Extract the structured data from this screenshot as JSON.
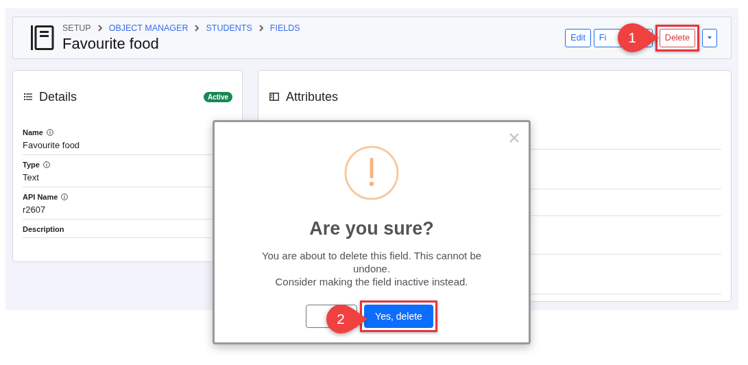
{
  "header": {
    "breadcrumb": [
      {
        "label": "SETUP",
        "link": false
      },
      {
        "label": "OBJECT MANAGER",
        "link": true
      },
      {
        "label": "STUDENTS",
        "link": true
      },
      {
        "label": "FIELDS",
        "link": true
      }
    ],
    "title": "Favourite food",
    "buttons": [
      {
        "label": "Edit",
        "kind": "outline",
        "highlighted": false
      },
      {
        "label": "Fi",
        "kind": "outline",
        "highlighted": false
      },
      {
        "label": "Delete",
        "kind": "danger",
        "highlighted": true
      },
      {
        "kind": "dropdown",
        "highlighted": false
      }
    ]
  },
  "details": {
    "title": "Details",
    "status": "Active",
    "fields": [
      {
        "label": "Name",
        "info": true,
        "value": "Favourite food"
      },
      {
        "label": "Type",
        "info": true,
        "value": "Text"
      },
      {
        "label": "API Name",
        "info": true,
        "value": "r2607"
      },
      {
        "label": "Description",
        "info": false
      }
    ]
  },
  "attributes": {
    "title": "Attributes"
  },
  "dialog": {
    "title": "Are you sure?",
    "message_lines": [
      "You are about to delete this field. This cannot be undone.",
      "Consider making the field inactive instead."
    ],
    "buttons": [
      {
        "kind": "cancel",
        "highlighted": false
      },
      {
        "kind": "confirm",
        "label": "Yes, delete",
        "highlighted": true
      }
    ]
  },
  "callouts": [
    {
      "number": "1"
    },
    {
      "number": "2"
    }
  ]
}
